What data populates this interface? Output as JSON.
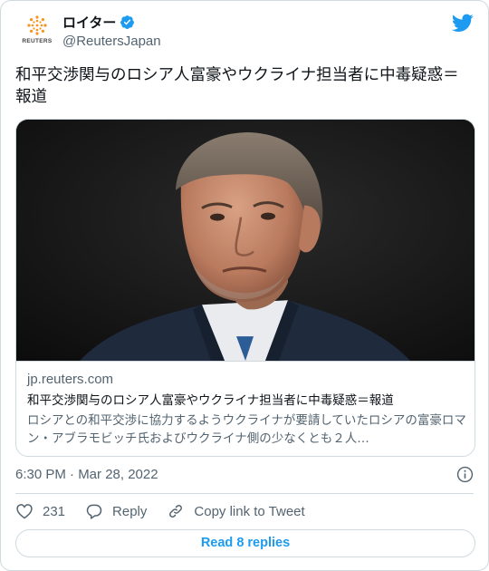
{
  "account": {
    "display_name": "ロイター",
    "handle": "@ReutersJapan",
    "logo_wordmark": "REUTERS",
    "verified": true,
    "verified_icon": "verified-badge-icon"
  },
  "brand": {
    "twitter_blue": "#1d9bf0",
    "text_primary": "#0f1419",
    "text_secondary": "#536471",
    "border": "#cfd9de",
    "reuters_orange": "#f7931e",
    "bird_icon": "twitter-bird-icon"
  },
  "tweet": {
    "text": "和平交渉関与のロシア人富豪やウクライナ担当者に中毒疑惑＝報道"
  },
  "card": {
    "domain": "jp.reuters.com",
    "title": "和平交渉関与のロシア人富豪やウクライナ担当者に中毒疑惑＝報道",
    "description": "ロシアとの和平交渉に協力するようウクライナが要請していたロシアの富豪ロマン・アブラモビッチ氏およびウクライナ側の少なくとも２人…",
    "image_icon": "article-photo-portrait"
  },
  "meta": {
    "timestamp": "6:30 PM · Mar 28, 2022",
    "info_icon": "info-icon"
  },
  "actions": {
    "like_count": "231",
    "reply_label": "Reply",
    "copy_link_label": "Copy link to Tweet"
  },
  "read_replies_label": "Read 8 replies"
}
